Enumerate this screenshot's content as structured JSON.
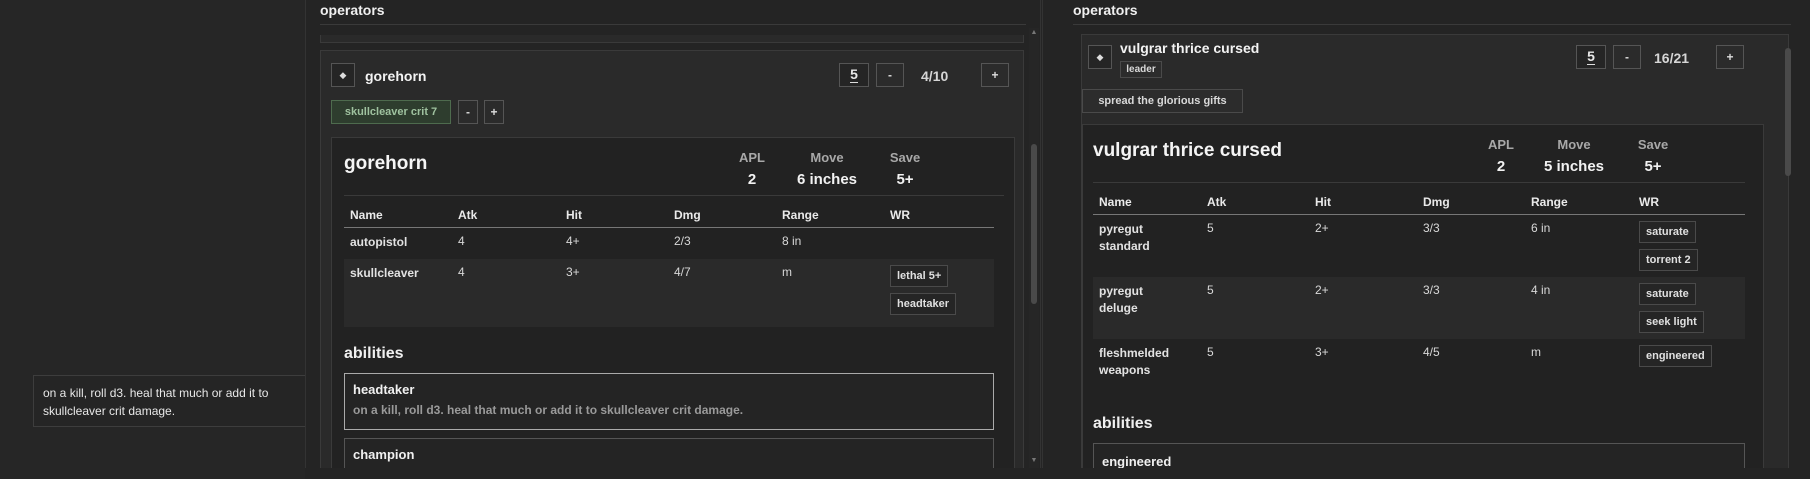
{
  "tooltip": {
    "text": "on a kill, roll d3. heal that much or add it to skullcleaver crit damage."
  },
  "columns": [
    {
      "title": "operators",
      "operator": {
        "toggle_icon": "diamond-icon",
        "name": "gorehorn",
        "stepper_value": "5",
        "minus_label": "-",
        "plus_label": "+",
        "wounds": "4/10",
        "active_rule": {
          "label": "skullcleaver crit 7",
          "minus_label": "-",
          "plus_label": "+"
        },
        "datacard": {
          "name": "gorehorn",
          "stats": [
            {
              "label": "APL",
              "value": "2"
            },
            {
              "label": "Move",
              "value": "6 inches"
            },
            {
              "label": "Save",
              "value": "5+"
            }
          ],
          "weapon_headers": [
            "Name",
            "Atk",
            "Hit",
            "Dmg",
            "Range",
            "WR"
          ],
          "weapons": [
            {
              "name": "autopistol",
              "atk": "4",
              "hit": "4+",
              "dmg": "2/3",
              "range": "8 in",
              "wr": []
            },
            {
              "name": "skullcleaver",
              "atk": "4",
              "hit": "3+",
              "dmg": "4/7",
              "range": "m",
              "wr": [
                "lethal 5+",
                "headtaker"
              ]
            }
          ],
          "abilities_title": "abilities",
          "abilities": [
            {
              "name": "headtaker",
              "desc": "on a kill, roll d3. heal that much or add it to skullcleaver crit damage."
            },
            {
              "name": "champion",
              "desc": ""
            }
          ]
        }
      }
    },
    {
      "title": "operators",
      "operator": {
        "toggle_icon": "diamond-icon",
        "name": "vulgrar thrice cursed",
        "badge": "leader",
        "stepper_value": "5",
        "minus_label": "-",
        "plus_label": "+",
        "wounds": "16/21",
        "action_button": "spread the glorious gifts",
        "datacard": {
          "name": "vulgrar thrice cursed",
          "stats": [
            {
              "label": "APL",
              "value": "2"
            },
            {
              "label": "Move",
              "value": "5 inches"
            },
            {
              "label": "Save",
              "value": "5+"
            }
          ],
          "weapon_headers": [
            "Name",
            "Atk",
            "Hit",
            "Dmg",
            "Range",
            "WR"
          ],
          "weapons": [
            {
              "name": "pyregut standard",
              "atk": "5",
              "hit": "2+",
              "dmg": "3/3",
              "range": "6 in",
              "wr": [
                "saturate",
                "torrent 2"
              ]
            },
            {
              "name": "pyregut deluge",
              "atk": "5",
              "hit": "2+",
              "dmg": "3/3",
              "range": "4 in",
              "wr": [
                "saturate",
                "seek light"
              ]
            },
            {
              "name": "fleshmelded weapons",
              "atk": "5",
              "hit": "3+",
              "dmg": "4/5",
              "range": "m",
              "wr": [
                "engineered"
              ]
            }
          ],
          "abilities_title": "abilities",
          "abilities": [
            {
              "name": "engineered",
              "desc": ""
            }
          ]
        }
      }
    }
  ]
}
